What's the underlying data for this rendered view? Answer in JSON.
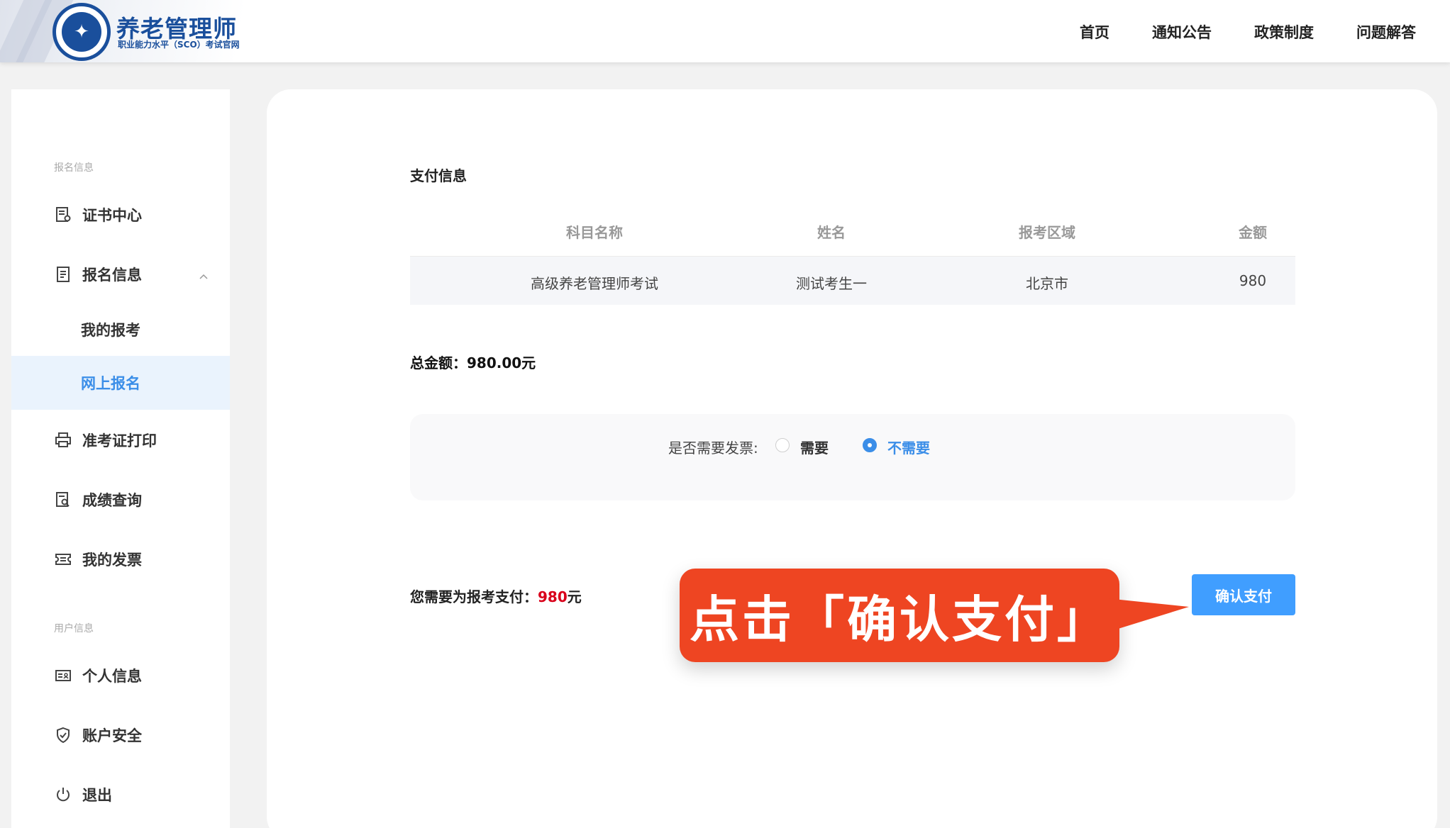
{
  "header": {
    "logo_title": "养老管理师",
    "logo_subtitle": "职业能力水平（SCO）考试官网",
    "nav": [
      "首页",
      "通知公告",
      "政策制度",
      "问题解答"
    ]
  },
  "sidebar": {
    "section_registration": "报名信息",
    "items": [
      {
        "label": "证书中心",
        "icon": "certificate-icon"
      },
      {
        "label": "报名信息",
        "icon": "form-icon"
      },
      {
        "label": "我的报考"
      },
      {
        "label": "网上报名"
      },
      {
        "label": "准考证打印",
        "icon": "printer-icon"
      },
      {
        "label": "成绩查询",
        "icon": "search-doc-icon"
      },
      {
        "label": "我的发票",
        "icon": "ticket-icon"
      }
    ],
    "section_user": "用户信息",
    "user_items": [
      {
        "label": "个人信息",
        "icon": "id-card-icon"
      },
      {
        "label": "账户安全",
        "icon": "shield-icon"
      },
      {
        "label": "退出",
        "icon": "power-icon"
      }
    ]
  },
  "payment": {
    "title": "支付信息",
    "columns": [
      "科目名称",
      "姓名",
      "报考区域",
      "金额"
    ],
    "row": [
      "高级养老管理师考试",
      "测试考生一",
      "北京市",
      "980"
    ],
    "total_label": "总金额：980.00元",
    "invoice_label": "是否需要发票:",
    "invoice_options": [
      "需要",
      "不需要"
    ],
    "invoice_selected": "不需要",
    "need_pay_label": "您需要为报考支付：",
    "need_pay_amount": "980",
    "need_pay_unit": "元",
    "confirm_button": "确认支付"
  },
  "callout": {
    "text": "点击「确认支付」"
  },
  "colors": {
    "accent": "#409eff",
    "active_bg": "#eaf3fd",
    "callout": "#ee4522",
    "amount": "#d9001b",
    "brand": "#1a4f9c"
  }
}
